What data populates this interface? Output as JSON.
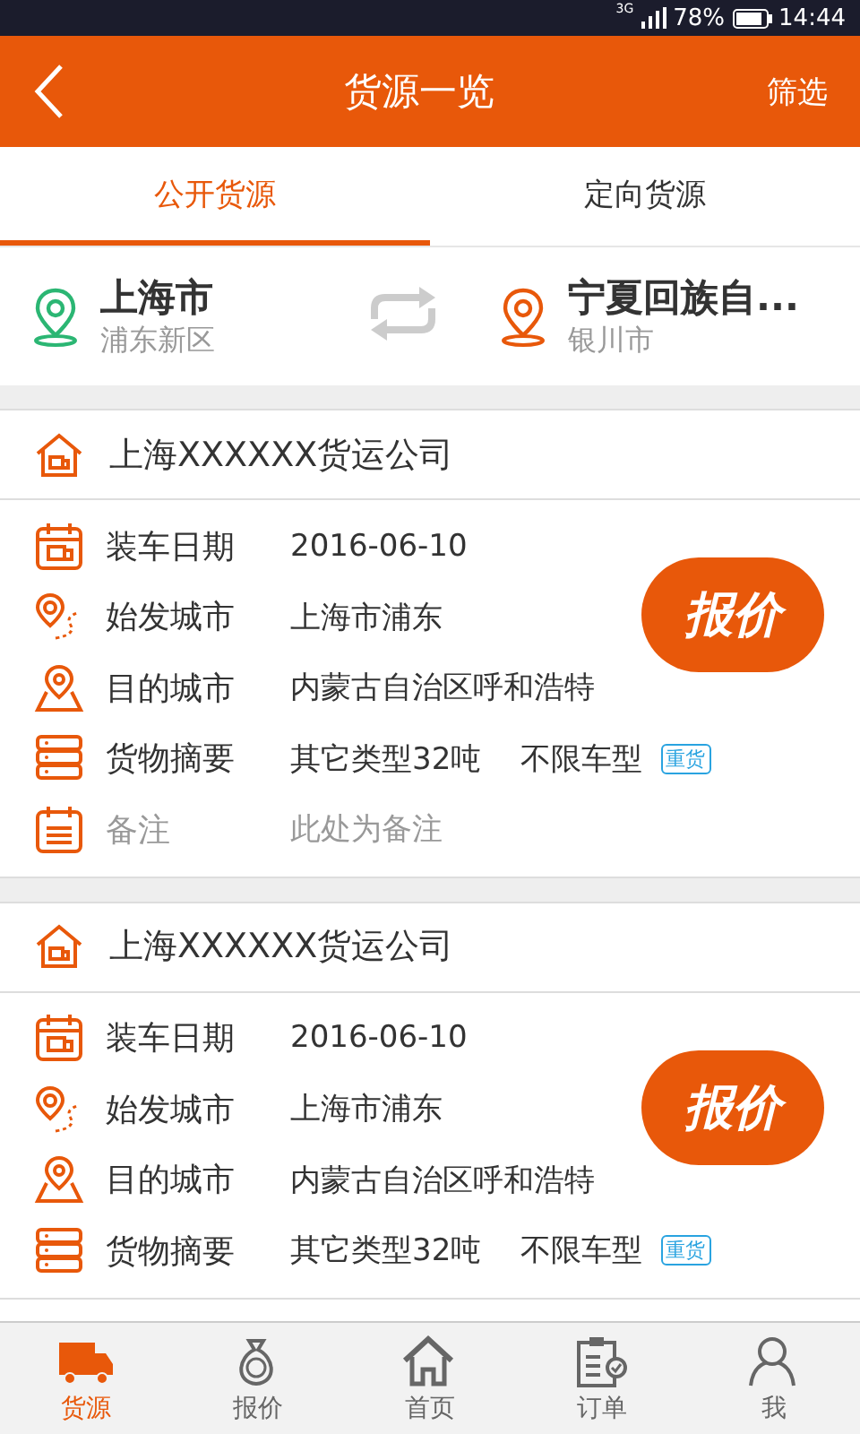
{
  "status_bar": {
    "network": "3G",
    "battery": "78%",
    "time": "14:44"
  },
  "header": {
    "title": "货源一览",
    "action": "筛选"
  },
  "tabs": [
    {
      "label": "公开货源",
      "selected": true
    },
    {
      "label": "定向货源",
      "selected": false
    }
  ],
  "route": {
    "from": {
      "city": "上海市",
      "district": "浦东新区"
    },
    "to": {
      "city": "宁夏回族自...",
      "district": "银川市"
    }
  },
  "cards": [
    {
      "company": "上海XXXXXX货运公司",
      "quote_button": "报价",
      "rows": [
        {
          "kind": "date",
          "label": "装车日期",
          "value": "2016-06-10"
        },
        {
          "kind": "origin",
          "label": "始发城市",
          "value": "上海市浦东"
        },
        {
          "kind": "destination",
          "label": "目的城市",
          "value": "内蒙古自治区呼和浩特"
        },
        {
          "kind": "cargo",
          "label": "货物摘要",
          "value": "其它类型32吨",
          "extra": "不限车型",
          "tag": "重货"
        },
        {
          "kind": "note",
          "label": "备注",
          "value": "此处为备注"
        }
      ]
    },
    {
      "company": "上海XXXXXX货运公司",
      "quote_button": "报价",
      "rows": [
        {
          "kind": "date",
          "label": "装车日期",
          "value": "2016-06-10"
        },
        {
          "kind": "origin",
          "label": "始发城市",
          "value": "上海市浦东"
        },
        {
          "kind": "destination",
          "label": "目的城市",
          "value": "内蒙古自治区呼和浩特"
        },
        {
          "kind": "cargo",
          "label": "货物摘要",
          "value": "其它类型32吨",
          "extra": "不限车型",
          "tag": "重货"
        }
      ]
    }
  ],
  "bottom_nav": [
    {
      "kind": "truck",
      "label": "货源",
      "selected": true
    },
    {
      "kind": "money",
      "label": "报价",
      "selected": false
    },
    {
      "kind": "home",
      "label": "首页",
      "selected": false
    },
    {
      "kind": "order",
      "label": "订单",
      "selected": false
    },
    {
      "kind": "user",
      "label": "我",
      "selected": false
    }
  ]
}
